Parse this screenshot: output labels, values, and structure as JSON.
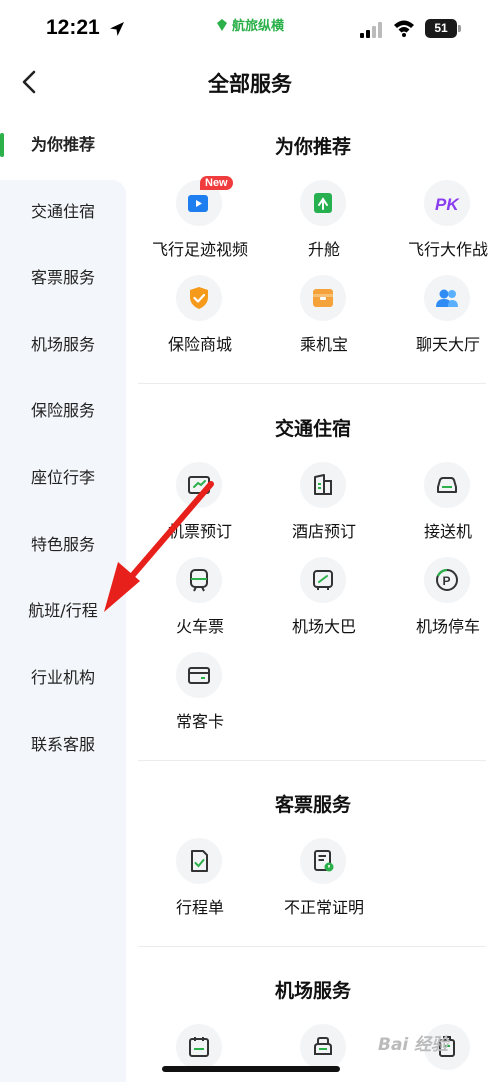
{
  "status_bar": {
    "time": "12:21",
    "app_brand": "航旅纵横",
    "battery": "51"
  },
  "nav": {
    "title": "全部服务"
  },
  "sidebar": {
    "items": [
      {
        "label": "为你推荐"
      },
      {
        "label": "交通住宿"
      },
      {
        "label": "客票服务"
      },
      {
        "label": "机场服务"
      },
      {
        "label": "保险服务"
      },
      {
        "label": "座位行李"
      },
      {
        "label": "特色服务"
      },
      {
        "label": "航班/行程"
      },
      {
        "label": "行业机构"
      },
      {
        "label": "联系客服"
      }
    ]
  },
  "sections": {
    "recommend": {
      "title": "为你推荐",
      "items": [
        {
          "label": "飞行足迹视频",
          "icon": "video-icon",
          "badge": "New"
        },
        {
          "label": "升舱",
          "icon": "upgrade-icon"
        },
        {
          "label": "飞行大作战",
          "icon": "pk-icon",
          "icon_text": "PK"
        },
        {
          "label": "保险商城",
          "icon": "shield-icon"
        },
        {
          "label": "乘机宝",
          "icon": "box-icon"
        },
        {
          "label": "聊天大厅",
          "icon": "chat-icon"
        }
      ]
    },
    "transport": {
      "title": "交通住宿",
      "items": [
        {
          "label": "机票预订",
          "icon": "ticket-icon"
        },
        {
          "label": "酒店预订",
          "icon": "hotel-icon"
        },
        {
          "label": "接送机",
          "icon": "car-icon"
        },
        {
          "label": "火车票",
          "icon": "train-icon"
        },
        {
          "label": "机场大巴",
          "icon": "bus-icon"
        },
        {
          "label": "机场停车",
          "icon": "parking-icon",
          "icon_text": "P"
        },
        {
          "label": "常客卡",
          "icon": "card-icon"
        }
      ]
    },
    "ticket": {
      "title": "客票服务",
      "items": [
        {
          "label": "行程单",
          "icon": "itinerary-icon"
        },
        {
          "label": "不正常证明",
          "icon": "certificate-icon"
        }
      ]
    },
    "airport": {
      "title": "机场服务",
      "items": [
        {
          "label": "",
          "icon": "calendar-icon"
        },
        {
          "label": "",
          "icon": "lounge-icon"
        },
        {
          "label": "",
          "icon": "luggage-icon"
        }
      ]
    }
  },
  "watermark": "Bai 经验",
  "colors": {
    "accent": "#2bb04a",
    "badge": "#f03c3c",
    "arrow": "#e8201c"
  }
}
